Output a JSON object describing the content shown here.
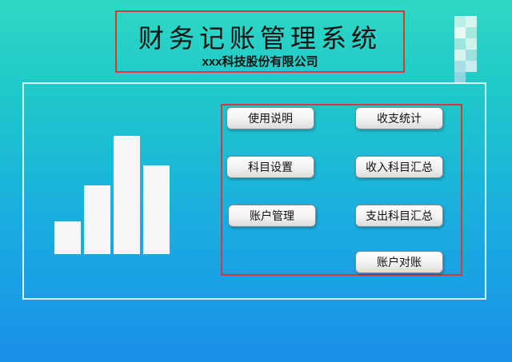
{
  "header": {
    "title": "财务记账管理系统",
    "subtitle": "xxx科技股份有限公司"
  },
  "chart_icon": {
    "icon": "bar-chart-icon",
    "bar_levels": [
      0.28,
      0.58,
      1.0,
      0.75
    ]
  },
  "buttons": {
    "usage_guide": "使用说明",
    "income_expense_stats": "收支统计",
    "account_subject_settings": "科目设置",
    "income_subject_summary": "收入科目汇总",
    "account_management": "账户管理",
    "expense_subject_summary": "支出科目汇总",
    "account_reconciliation": "账户对账"
  },
  "colors": {
    "highlight_border": "#d9363e",
    "button_bg": "#f1f1f1"
  }
}
